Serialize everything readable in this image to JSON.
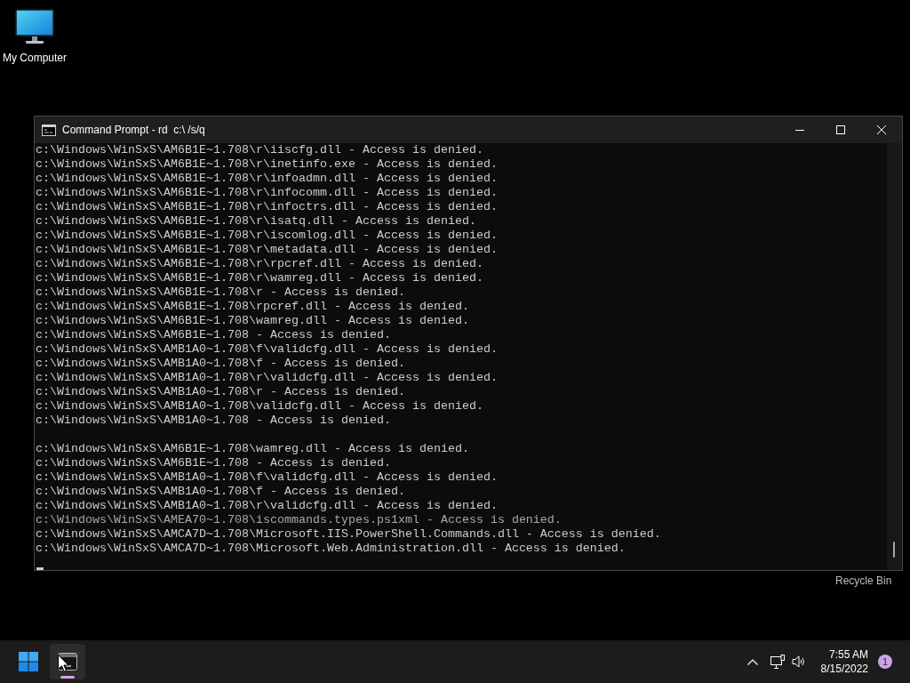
{
  "desktop": {
    "shortcuts": [
      {
        "kind": "computer",
        "label": "My Computer"
      },
      {
        "kind": "recycle_bin",
        "label": "Recycle Bin"
      }
    ]
  },
  "window": {
    "title": "Command Prompt - rd  c:\\ /s/q",
    "lines": [
      {
        "kind": "output",
        "text": "c:\\Windows\\WinSxS\\AM6B1E~1.708\\r\\iiscfg.dll - Access is denied."
      },
      {
        "kind": "output",
        "text": "c:\\Windows\\WinSxS\\AM6B1E~1.708\\r\\inetinfo.exe - Access is denied."
      },
      {
        "kind": "output",
        "text": "c:\\Windows\\WinSxS\\AM6B1E~1.708\\r\\infoadmn.dll - Access is denied."
      },
      {
        "kind": "output",
        "text": "c:\\Windows\\WinSxS\\AM6B1E~1.708\\r\\infocomm.dll - Access is denied."
      },
      {
        "kind": "output",
        "text": "c:\\Windows\\WinSxS\\AM6B1E~1.708\\r\\infoctrs.dll - Access is denied."
      },
      {
        "kind": "output",
        "text": "c:\\Windows\\WinSxS\\AM6B1E~1.708\\r\\isatq.dll - Access is denied."
      },
      {
        "kind": "output",
        "text": "c:\\Windows\\WinSxS\\AM6B1E~1.708\\r\\iscomlog.dll - Access is denied."
      },
      {
        "kind": "output",
        "text": "c:\\Windows\\WinSxS\\AM6B1E~1.708\\r\\metadata.dll - Access is denied."
      },
      {
        "kind": "output",
        "text": "c:\\Windows\\WinSxS\\AM6B1E~1.708\\r\\rpcref.dll - Access is denied."
      },
      {
        "kind": "output",
        "text": "c:\\Windows\\WinSxS\\AM6B1E~1.708\\r\\wamreg.dll - Access is denied."
      },
      {
        "kind": "output",
        "text": "c:\\Windows\\WinSxS\\AM6B1E~1.708\\r - Access is denied."
      },
      {
        "kind": "output",
        "text": "c:\\Windows\\WinSxS\\AM6B1E~1.708\\rpcref.dll - Access is denied."
      },
      {
        "kind": "output",
        "text": "c:\\Windows\\WinSxS\\AM6B1E~1.708\\wamreg.dll - Access is denied."
      },
      {
        "kind": "output",
        "text": "c:\\Windows\\WinSxS\\AM6B1E~1.708 - Access is denied."
      },
      {
        "kind": "output",
        "text": "c:\\Windows\\WinSxS\\AMB1A0~1.708\\f\\validcfg.dll - Access is denied."
      },
      {
        "kind": "output",
        "text": "c:\\Windows\\WinSxS\\AMB1A0~1.708\\f - Access is denied."
      },
      {
        "kind": "output",
        "text": "c:\\Windows\\WinSxS\\AMB1A0~1.708\\r\\validcfg.dll - Access is denied."
      },
      {
        "kind": "output",
        "text": "c:\\Windows\\WinSxS\\AMB1A0~1.708\\r - Access is denied."
      },
      {
        "kind": "output",
        "text": "c:\\Windows\\WinSxS\\AMB1A0~1.708\\validcfg.dll - Access is denied."
      },
      {
        "kind": "output",
        "text": "c:\\Windows\\WinSxS\\AMB1A0~1.708 - Access is denied."
      },
      {
        "kind": "blank"
      },
      {
        "kind": "output",
        "text": "c:\\Windows\\WinSxS\\AM6B1E~1.708\\wamreg.dll - Access is denied."
      },
      {
        "kind": "output",
        "text": "c:\\Windows\\WinSxS\\AM6B1E~1.708 - Access is denied."
      },
      {
        "kind": "output",
        "text": "c:\\Windows\\WinSxS\\AMB1A0~1.708\\f\\validcfg.dll - Access is denied."
      },
      {
        "kind": "output",
        "text": "c:\\Windows\\WinSxS\\AMB1A0~1.708\\f - Access is denied."
      },
      {
        "kind": "output",
        "text": "c:\\Windows\\WinSxS\\AMB1A0~1.708\\r\\validcfg.dll - Access is denied."
      },
      {
        "kind": "garbled",
        "text": "c:\\Windows\\WinSxS\\AMEA70~1.708\\iscommands.types.ps1xml - Access is denied."
      },
      {
        "kind": "output",
        "text": "c:\\Windows\\WinSxS\\AMCA7D~1.708\\Microsoft.IIS.PowerShell.Commands.dll - Access is denied."
      },
      {
        "kind": "output",
        "text": "c:\\Windows\\WinSxS\\AMCA7D~1.708\\Microsoft.Web.Administration.dll - Access is denied."
      }
    ]
  },
  "taskbar": {
    "apps": [
      {
        "kind": "terminal",
        "selected": true
      }
    ],
    "tray": {
      "time": "7:55 AM",
      "date": "8/15/2022",
      "notification_count": "1"
    }
  }
}
